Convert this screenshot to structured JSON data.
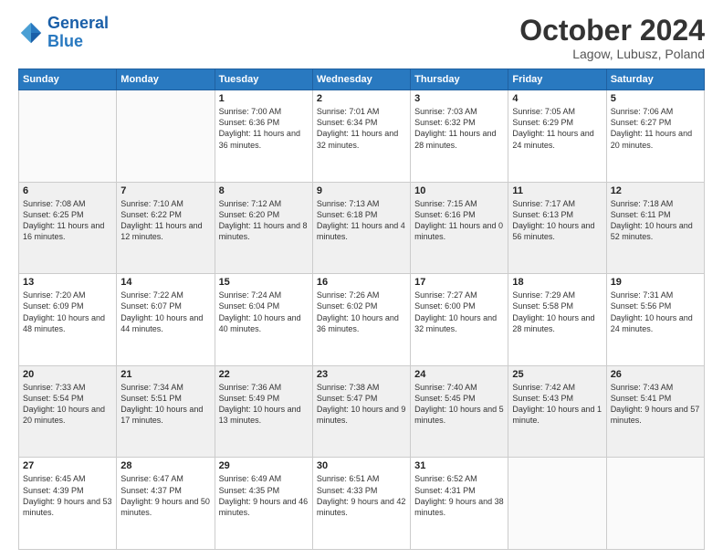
{
  "header": {
    "logo_line1": "General",
    "logo_line2": "Blue",
    "month": "October 2024",
    "location": "Lagow, Lubusz, Poland"
  },
  "days_of_week": [
    "Sunday",
    "Monday",
    "Tuesday",
    "Wednesday",
    "Thursday",
    "Friday",
    "Saturday"
  ],
  "weeks": [
    [
      {
        "day": "",
        "text": ""
      },
      {
        "day": "",
        "text": ""
      },
      {
        "day": "1",
        "text": "Sunrise: 7:00 AM\nSunset: 6:36 PM\nDaylight: 11 hours and 36 minutes."
      },
      {
        "day": "2",
        "text": "Sunrise: 7:01 AM\nSunset: 6:34 PM\nDaylight: 11 hours and 32 minutes."
      },
      {
        "day": "3",
        "text": "Sunrise: 7:03 AM\nSunset: 6:32 PM\nDaylight: 11 hours and 28 minutes."
      },
      {
        "day": "4",
        "text": "Sunrise: 7:05 AM\nSunset: 6:29 PM\nDaylight: 11 hours and 24 minutes."
      },
      {
        "day": "5",
        "text": "Sunrise: 7:06 AM\nSunset: 6:27 PM\nDaylight: 11 hours and 20 minutes."
      }
    ],
    [
      {
        "day": "6",
        "text": "Sunrise: 7:08 AM\nSunset: 6:25 PM\nDaylight: 11 hours and 16 minutes."
      },
      {
        "day": "7",
        "text": "Sunrise: 7:10 AM\nSunset: 6:22 PM\nDaylight: 11 hours and 12 minutes."
      },
      {
        "day": "8",
        "text": "Sunrise: 7:12 AM\nSunset: 6:20 PM\nDaylight: 11 hours and 8 minutes."
      },
      {
        "day": "9",
        "text": "Sunrise: 7:13 AM\nSunset: 6:18 PM\nDaylight: 11 hours and 4 minutes."
      },
      {
        "day": "10",
        "text": "Sunrise: 7:15 AM\nSunset: 6:16 PM\nDaylight: 11 hours and 0 minutes."
      },
      {
        "day": "11",
        "text": "Sunrise: 7:17 AM\nSunset: 6:13 PM\nDaylight: 10 hours and 56 minutes."
      },
      {
        "day": "12",
        "text": "Sunrise: 7:18 AM\nSunset: 6:11 PM\nDaylight: 10 hours and 52 minutes."
      }
    ],
    [
      {
        "day": "13",
        "text": "Sunrise: 7:20 AM\nSunset: 6:09 PM\nDaylight: 10 hours and 48 minutes."
      },
      {
        "day": "14",
        "text": "Sunrise: 7:22 AM\nSunset: 6:07 PM\nDaylight: 10 hours and 44 minutes."
      },
      {
        "day": "15",
        "text": "Sunrise: 7:24 AM\nSunset: 6:04 PM\nDaylight: 10 hours and 40 minutes."
      },
      {
        "day": "16",
        "text": "Sunrise: 7:26 AM\nSunset: 6:02 PM\nDaylight: 10 hours and 36 minutes."
      },
      {
        "day": "17",
        "text": "Sunrise: 7:27 AM\nSunset: 6:00 PM\nDaylight: 10 hours and 32 minutes."
      },
      {
        "day": "18",
        "text": "Sunrise: 7:29 AM\nSunset: 5:58 PM\nDaylight: 10 hours and 28 minutes."
      },
      {
        "day": "19",
        "text": "Sunrise: 7:31 AM\nSunset: 5:56 PM\nDaylight: 10 hours and 24 minutes."
      }
    ],
    [
      {
        "day": "20",
        "text": "Sunrise: 7:33 AM\nSunset: 5:54 PM\nDaylight: 10 hours and 20 minutes."
      },
      {
        "day": "21",
        "text": "Sunrise: 7:34 AM\nSunset: 5:51 PM\nDaylight: 10 hours and 17 minutes."
      },
      {
        "day": "22",
        "text": "Sunrise: 7:36 AM\nSunset: 5:49 PM\nDaylight: 10 hours and 13 minutes."
      },
      {
        "day": "23",
        "text": "Sunrise: 7:38 AM\nSunset: 5:47 PM\nDaylight: 10 hours and 9 minutes."
      },
      {
        "day": "24",
        "text": "Sunrise: 7:40 AM\nSunset: 5:45 PM\nDaylight: 10 hours and 5 minutes."
      },
      {
        "day": "25",
        "text": "Sunrise: 7:42 AM\nSunset: 5:43 PM\nDaylight: 10 hours and 1 minute."
      },
      {
        "day": "26",
        "text": "Sunrise: 7:43 AM\nSunset: 5:41 PM\nDaylight: 9 hours and 57 minutes."
      }
    ],
    [
      {
        "day": "27",
        "text": "Sunrise: 6:45 AM\nSunset: 4:39 PM\nDaylight: 9 hours and 53 minutes."
      },
      {
        "day": "28",
        "text": "Sunrise: 6:47 AM\nSunset: 4:37 PM\nDaylight: 9 hours and 50 minutes."
      },
      {
        "day": "29",
        "text": "Sunrise: 6:49 AM\nSunset: 4:35 PM\nDaylight: 9 hours and 46 minutes."
      },
      {
        "day": "30",
        "text": "Sunrise: 6:51 AM\nSunset: 4:33 PM\nDaylight: 9 hours and 42 minutes."
      },
      {
        "day": "31",
        "text": "Sunrise: 6:52 AM\nSunset: 4:31 PM\nDaylight: 9 hours and 38 minutes."
      },
      {
        "day": "",
        "text": ""
      },
      {
        "day": "",
        "text": ""
      }
    ]
  ]
}
